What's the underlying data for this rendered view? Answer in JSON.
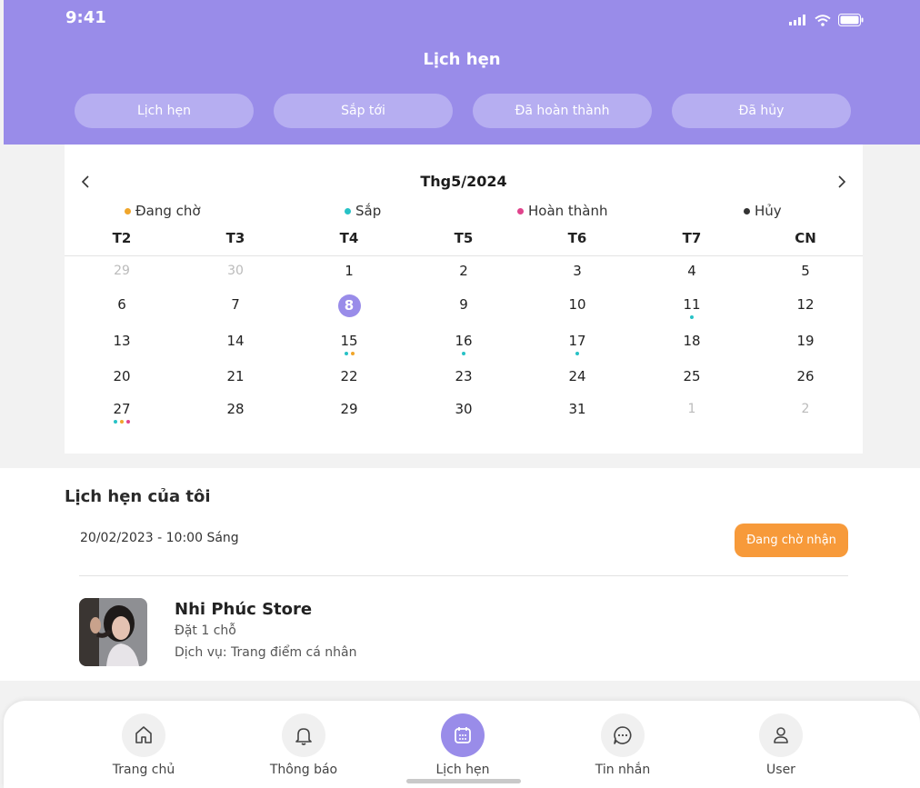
{
  "status_bar": {
    "time": "9:41"
  },
  "header": {
    "title": "Lịch hẹn"
  },
  "tabs": [
    {
      "label": "Lịch hẹn"
    },
    {
      "label": "Sắp tới"
    },
    {
      "label": "Đã hoàn thành"
    },
    {
      "label": "Đã hủy"
    }
  ],
  "calendar": {
    "month_title": "Thg5/2024",
    "legend": [
      {
        "label": "Đang chờ",
        "color": "#f0a62b"
      },
      {
        "label": "Sắp",
        "color": "#27c2c6"
      },
      {
        "label": "Hoàn thành",
        "color": "#e0438c"
      },
      {
        "label": "Hủy",
        "color": "#333333"
      }
    ],
    "weekdays": [
      "T2",
      "T3",
      "T4",
      "T5",
      "T6",
      "T7",
      "CN"
    ],
    "weeks": [
      [
        {
          "d": "29",
          "muted": true
        },
        {
          "d": "30",
          "muted": true
        },
        {
          "d": "1"
        },
        {
          "d": "2"
        },
        {
          "d": "3"
        },
        {
          "d": "4"
        },
        {
          "d": "5"
        }
      ],
      [
        {
          "d": "6"
        },
        {
          "d": "7"
        },
        {
          "d": "8",
          "selected": true
        },
        {
          "d": "9"
        },
        {
          "d": "10"
        },
        {
          "d": "11",
          "dots": [
            "#27c2c6"
          ]
        },
        {
          "d": "12"
        }
      ],
      [
        {
          "d": "13"
        },
        {
          "d": "14"
        },
        {
          "d": "15",
          "dots": [
            "#27c2c6",
            "#f0a62b"
          ]
        },
        {
          "d": "16",
          "dots": [
            "#27c2c6"
          ]
        },
        {
          "d": "17",
          "dots": [
            "#27c2c6"
          ]
        },
        {
          "d": "18"
        },
        {
          "d": "19"
        }
      ],
      [
        {
          "d": "20"
        },
        {
          "d": "21"
        },
        {
          "d": "22"
        },
        {
          "d": "23"
        },
        {
          "d": "24"
        },
        {
          "d": "25"
        },
        {
          "d": "26"
        }
      ],
      [
        {
          "d": "27",
          "dots": [
            "#27c2c6",
            "#f0a62b",
            "#e0438c"
          ]
        },
        {
          "d": "28"
        },
        {
          "d": "29"
        },
        {
          "d": "30"
        },
        {
          "d": "31"
        },
        {
          "d": "1",
          "muted": true
        },
        {
          "d": "2",
          "muted": true
        }
      ]
    ]
  },
  "appointments": {
    "section_title": "Lịch hẹn của tôi",
    "item": {
      "datetime": "20/02/2023 - 10:00 Sáng",
      "status": "Đang chờ nhận",
      "store_name": "Nhi Phúc Store",
      "seat": "Đặt 1 chỗ",
      "service": "Dịch vụ: Trang điểm cá nhân"
    }
  },
  "bottom_nav": [
    {
      "label": "Trang chủ",
      "icon": "home-icon"
    },
    {
      "label": "Thông báo",
      "icon": "bell-icon"
    },
    {
      "label": "Lịch hẹn",
      "icon": "calendar-icon",
      "active": true
    },
    {
      "label": "Tin nhắn",
      "icon": "chat-icon"
    },
    {
      "label": "User",
      "icon": "user-icon"
    }
  ],
  "colors": {
    "accent": "#998ce9",
    "status_orange": "#f79a3a"
  }
}
